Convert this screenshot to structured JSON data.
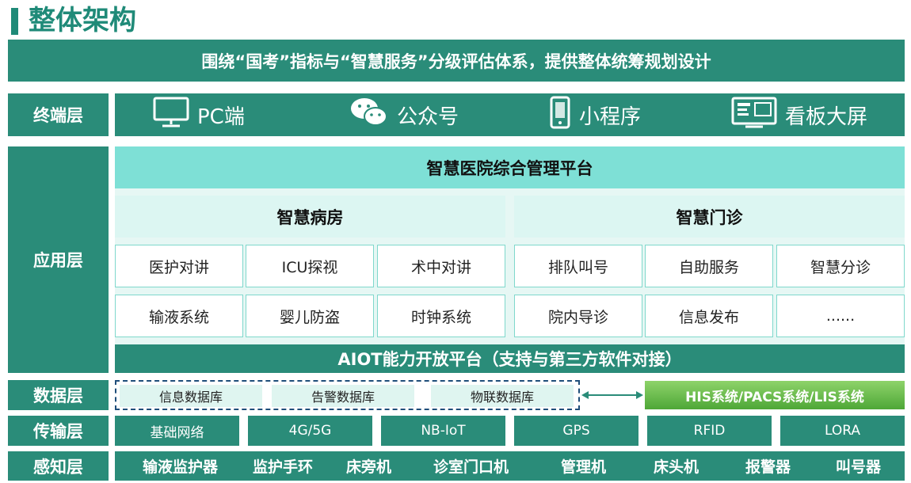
{
  "title": "整体架构",
  "top_banner": "围绕“国考”指标与“智慧服务”分级评估体系，提供整体统筹规划设计",
  "layers": {
    "terminal": "终端层",
    "application": "应用层",
    "data": "数据层",
    "transport": "传输层",
    "perception": "感知层"
  },
  "terminals": [
    {
      "icon": "monitor-icon",
      "label": "PC端"
    },
    {
      "icon": "wechat-icon",
      "label": "公众号"
    },
    {
      "icon": "mini-program-icon",
      "label": "小程序"
    },
    {
      "icon": "dashboard-screen-icon",
      "label": "看板大屏"
    }
  ],
  "application": {
    "platform": "智慧医院综合管理平台",
    "left_group": {
      "title": "智慧病房",
      "rows": [
        [
          "医护对讲",
          "ICU探视",
          "术中对讲"
        ],
        [
          "输液系统",
          "婴儿防盗",
          "时钟系统"
        ]
      ]
    },
    "right_group": {
      "title": "智慧门诊",
      "rows": [
        [
          "排队叫号",
          "自助服务",
          "智慧分诊"
        ],
        [
          "院内导诊",
          "信息发布",
          "......"
        ]
      ]
    },
    "aiot": "AIOT能力开放平台（支持与第三方软件对接）"
  },
  "data_layer": {
    "databases": [
      "信息数据库",
      "告警数据库",
      "物联数据库"
    ],
    "external": "HIS系统/PACS系统/LIS系统"
  },
  "transport": [
    "基础网络",
    "4G/5G",
    "NB-IoT",
    "GPS",
    "RFID",
    "LORA"
  ],
  "perception": [
    "输液监护器",
    "监护手环",
    "床旁机",
    "诊室门口机",
    "管理机",
    "床头机",
    "报警器",
    "叫号器"
  ],
  "colors": {
    "dark_teal": "#2a8c79",
    "light_teal": "#7ee0d6",
    "pale_teal": "#dcf6f2",
    "green": "#4ea737",
    "dashed_navy": "#1f4e7a"
  }
}
